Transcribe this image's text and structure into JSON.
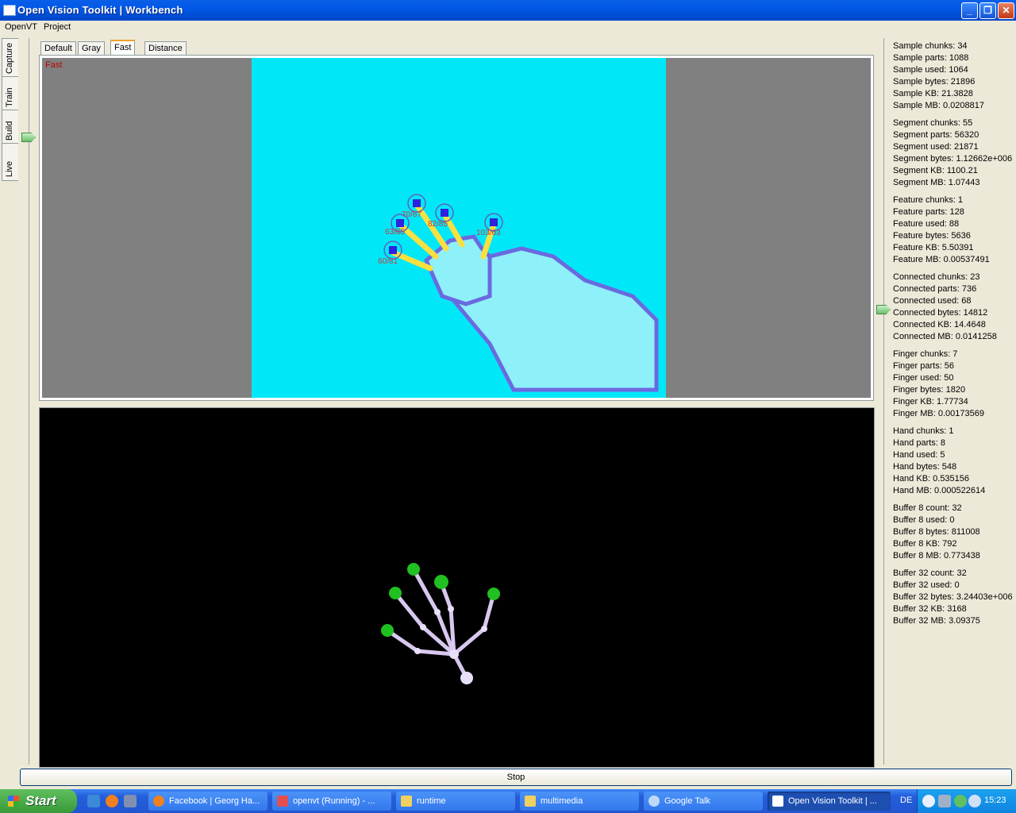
{
  "window": {
    "title": "Open Vision Toolkit | Workbench"
  },
  "menu": [
    "OpenVT",
    "Project"
  ],
  "side_tabs": [
    "Capture",
    "Train",
    "Build",
    "Live"
  ],
  "view_tabs": [
    "Default",
    "Gray",
    "Fast",
    "Distance"
  ],
  "view_active": "Fast",
  "overlay_label": "Fast",
  "finger_labels": [
    "70/87",
    "82/85",
    "63/85",
    "103/63",
    "60/81"
  ],
  "stats": [
    [
      "Sample chunks: 34",
      "Sample parts: 1088",
      "Sample used: 1064",
      "Sample bytes: 21896",
      "Sample KB: 21.3828",
      "Sample MB: 0.0208817"
    ],
    [
      "Segment chunks: 55",
      "Segment parts: 56320",
      "Segment used: 21871",
      "Segment bytes: 1.12662e+006",
      "Segment KB: 1100.21",
      "Segment MB: 1.07443"
    ],
    [
      "Feature chunks: 1",
      "Feature parts: 128",
      "Feature used: 88",
      "Feature bytes: 5636",
      "Feature KB: 5.50391",
      "Feature MB: 0.00537491"
    ],
    [
      "Connected chunks: 23",
      "Connected parts: 736",
      "Connected used: 68",
      "Connected bytes: 14812",
      "Connected KB: 14.4648",
      "Connected MB: 0.0141258"
    ],
    [
      "Finger chunks: 7",
      "Finger parts: 56",
      "Finger used: 50",
      "Finger bytes: 1820",
      "Finger KB: 1.77734",
      "Finger MB: 0.00173569"
    ],
    [
      "Hand chunks: 1",
      "Hand parts: 8",
      "Hand used: 5",
      "Hand bytes: 548",
      "Hand KB: 0.535156",
      "Hand MB: 0.000522614"
    ],
    [
      "Buffer 8 count: 32",
      "Buffer 8 used: 0",
      "Buffer 8 bytes: 811008",
      "Buffer 8 KB: 792",
      "Buffer 8 MB: 0.773438"
    ],
    [
      "Buffer 32 count: 32",
      "Buffer 32 used: 0",
      "Buffer 32 bytes: 3.24403e+006",
      "Buffer 32 KB: 3168",
      "Buffer 32 MB: 3.09375"
    ]
  ],
  "stop_label": "Stop",
  "taskbar": {
    "start": "Start",
    "tasks": [
      "Facebook | Georg Ha...",
      "openvt (Running) - ...",
      "runtime",
      "multimedia",
      "Google Talk",
      "Open Vision Toolkit | ..."
    ],
    "lang": "DE",
    "clock": "15:23"
  }
}
